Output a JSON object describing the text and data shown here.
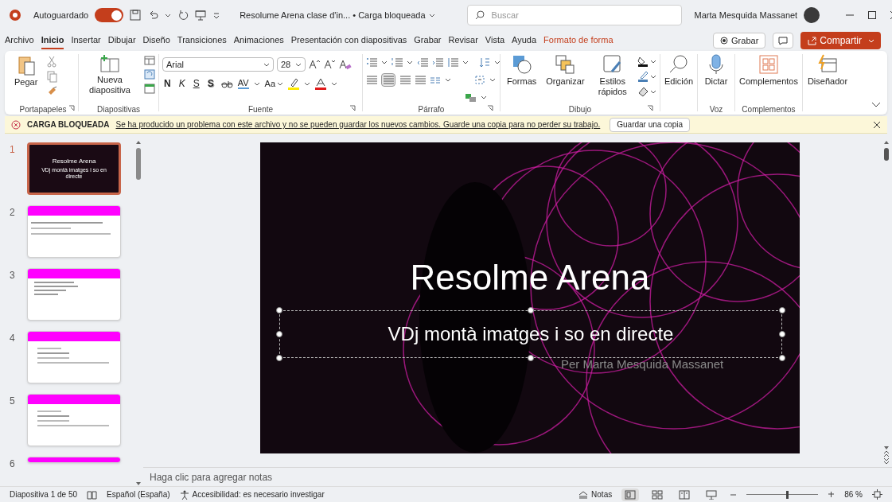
{
  "title_bar": {
    "autosave_label": "Autoguardado",
    "autosave_on": true,
    "document_title": "Resolume Arena clase d'in... • Carga bloqueada",
    "search_placeholder": "Buscar",
    "user_name": "Marta Mesquida Massanet"
  },
  "ribbon_tabs": [
    {
      "label": "Archivo",
      "selected": false,
      "kind": "tab"
    },
    {
      "label": "Inicio",
      "selected": true,
      "kind": "tab"
    },
    {
      "label": "Insertar",
      "selected": false,
      "kind": "tab"
    },
    {
      "label": "Dibujar",
      "selected": false,
      "kind": "tab"
    },
    {
      "label": "Diseño",
      "selected": false,
      "kind": "tab"
    },
    {
      "label": "Transiciones",
      "selected": false,
      "kind": "tab"
    },
    {
      "label": "Animaciones",
      "selected": false,
      "kind": "tab"
    },
    {
      "label": "Presentación con diapositivas",
      "selected": false,
      "kind": "tab"
    },
    {
      "label": "Grabar",
      "selected": false,
      "kind": "tab"
    },
    {
      "label": "Revisar",
      "selected": false,
      "kind": "tab"
    },
    {
      "label": "Vista",
      "selected": false,
      "kind": "tab"
    },
    {
      "label": "Ayuda",
      "selected": false,
      "kind": "tab"
    },
    {
      "label": "Formato de forma",
      "selected": false,
      "kind": "contextual"
    }
  ],
  "ribbon_actions": {
    "record": "Grabar",
    "share": "Compartir"
  },
  "ribbon": {
    "clipboard": {
      "label": "Portapapeles",
      "paste": "Pegar"
    },
    "slides": {
      "label": "Diapositivas",
      "new_slide": "Nueva diapositiva"
    },
    "font": {
      "label": "Fuente",
      "font_name": "Arial",
      "font_size": "28",
      "format_buttons": [
        "N",
        "K",
        "S",
        "S"
      ],
      "spacing": "AV",
      "case": "Aa"
    },
    "paragraph": {
      "label": "Párrafo"
    },
    "drawing": {
      "label": "Dibujo",
      "shapes": "Formas",
      "arrange": "Organizar",
      "quick_styles": "Estilos rápidos"
    },
    "editing": {
      "button": "Edición"
    },
    "voice": {
      "label": "Voz",
      "dictate": "Dictar"
    },
    "addins": {
      "label": "Complementos",
      "button": "Complementos"
    },
    "designer": {
      "button": "Diseñador"
    }
  },
  "warning_bar": {
    "title": "CARGA BLOQUEADA",
    "message": "Se ha producido un problema con este archivo y no se pueden guardar los nuevos cambios. Guarde una copia para no perder su trabajo.",
    "button": "Guardar una copia"
  },
  "thumbnails": [
    {
      "number": "1",
      "selected": true,
      "kind": "title",
      "title": "Resolme Arena",
      "subtitle": "VDj montà imatges i so en directe"
    },
    {
      "number": "2",
      "selected": false,
      "kind": "text"
    },
    {
      "number": "3",
      "selected": false,
      "kind": "bullets"
    },
    {
      "number": "4",
      "selected": false,
      "kind": "links"
    },
    {
      "number": "5",
      "selected": false,
      "kind": "links"
    },
    {
      "number": "6",
      "selected": false,
      "kind": "partial"
    }
  ],
  "slide": {
    "title": "Resolme Arena",
    "subtitle": "VDj montà imatges i so en directe",
    "author": "Per Marta Mesquida Massanet"
  },
  "notes_placeholder": "Haga clic para agregar notas",
  "status_bar": {
    "slide_position": "Diapositiva 1 de 50",
    "language": "Español (España)",
    "accessibility": "Accesibilidad: es necesario investigar",
    "notes": "Notas",
    "views": [
      {
        "kind": "normal",
        "selected": true
      },
      {
        "kind": "sorter",
        "selected": false
      },
      {
        "kind": "reading",
        "selected": false
      },
      {
        "kind": "presenter",
        "selected": false
      }
    ],
    "zoom": {
      "level": 0.55
    },
    "zoom_reading": "86 %"
  }
}
